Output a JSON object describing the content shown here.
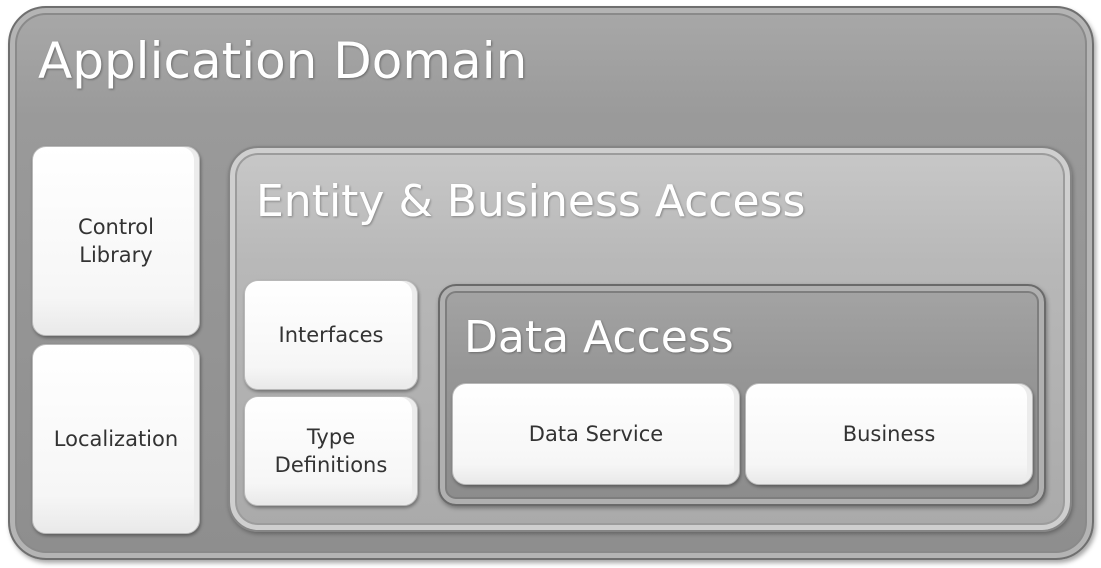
{
  "diagram": {
    "application_domain": "Application Domain",
    "control_library": [
      "Control",
      "Library"
    ],
    "localization": "Localization",
    "entity_business_access": "Entity & Business Access",
    "interfaces": "Interfaces",
    "type_definitions": [
      "Type",
      "Definitions"
    ],
    "data_access": "Data Access",
    "data_service": "Data Service",
    "business": "Business"
  }
}
